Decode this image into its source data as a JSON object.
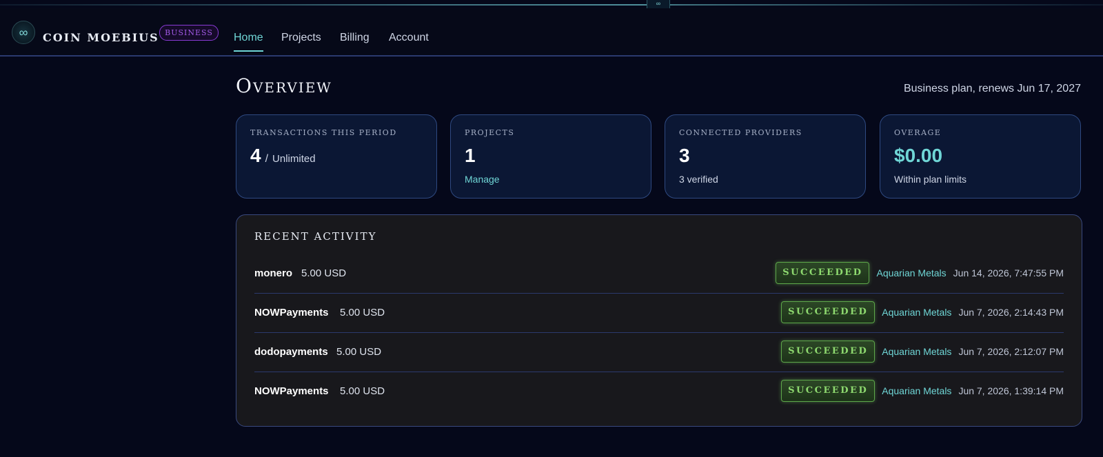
{
  "header": {
    "logo_symbol": "∞",
    "clasp_symbol": "∞",
    "brand": "COIN MOEBIUS",
    "plan_badge": "BUSINESS",
    "nav": [
      {
        "label": "Home",
        "active": true
      },
      {
        "label": "Projects",
        "active": false
      },
      {
        "label": "Billing",
        "active": false
      },
      {
        "label": "Account",
        "active": false
      }
    ]
  },
  "page": {
    "title": "Overview",
    "plan_text": "Business plan, renews Jun 17, 2027"
  },
  "cards": {
    "transactions": {
      "label": "TRANSACTIONS THIS PERIOD",
      "value": "4",
      "slash": "/",
      "suffix": "Unlimited"
    },
    "projects": {
      "label": "PROJECTS",
      "value": "1",
      "sub": "Manage"
    },
    "providers": {
      "label": "CONNECTED PROVIDERS",
      "value": "3",
      "sub": "3 verified"
    },
    "overage": {
      "label": "OVERAGE",
      "value": "$0.00",
      "sub": "Within plan limits"
    }
  },
  "activity": {
    "title": "RECENT ACTIVITY",
    "rows": [
      {
        "provider": "monero",
        "amount": "5.00 USD",
        "status": "SUCCEEDED",
        "merchant": "Aquarian Metals",
        "time": "Jun 14, 2026, 7:47:55 PM"
      },
      {
        "provider": "NOWPayments",
        "amount": "5.00 USD",
        "status": "SUCCEEDED",
        "merchant": "Aquarian Metals",
        "time": "Jun 7, 2026, 2:14:43 PM"
      },
      {
        "provider": "dodopayments",
        "amount": "5.00 USD",
        "status": "SUCCEEDED",
        "merchant": "Aquarian Metals",
        "time": "Jun 7, 2026, 2:12:07 PM"
      },
      {
        "provider": "NOWPayments",
        "amount": "5.00 USD",
        "status": "SUCCEEDED",
        "merchant": "Aquarian Metals",
        "time": "Jun 7, 2026, 1:39:14 PM"
      }
    ]
  },
  "colors": {
    "accent_teal": "#6fd6d6",
    "badge_purple": "#8a3bd6",
    "success_green": "#8ed96f",
    "background": "#05081a"
  },
  "icons": {
    "logo": "infinity-icon",
    "clasp": "infinity-icon"
  }
}
